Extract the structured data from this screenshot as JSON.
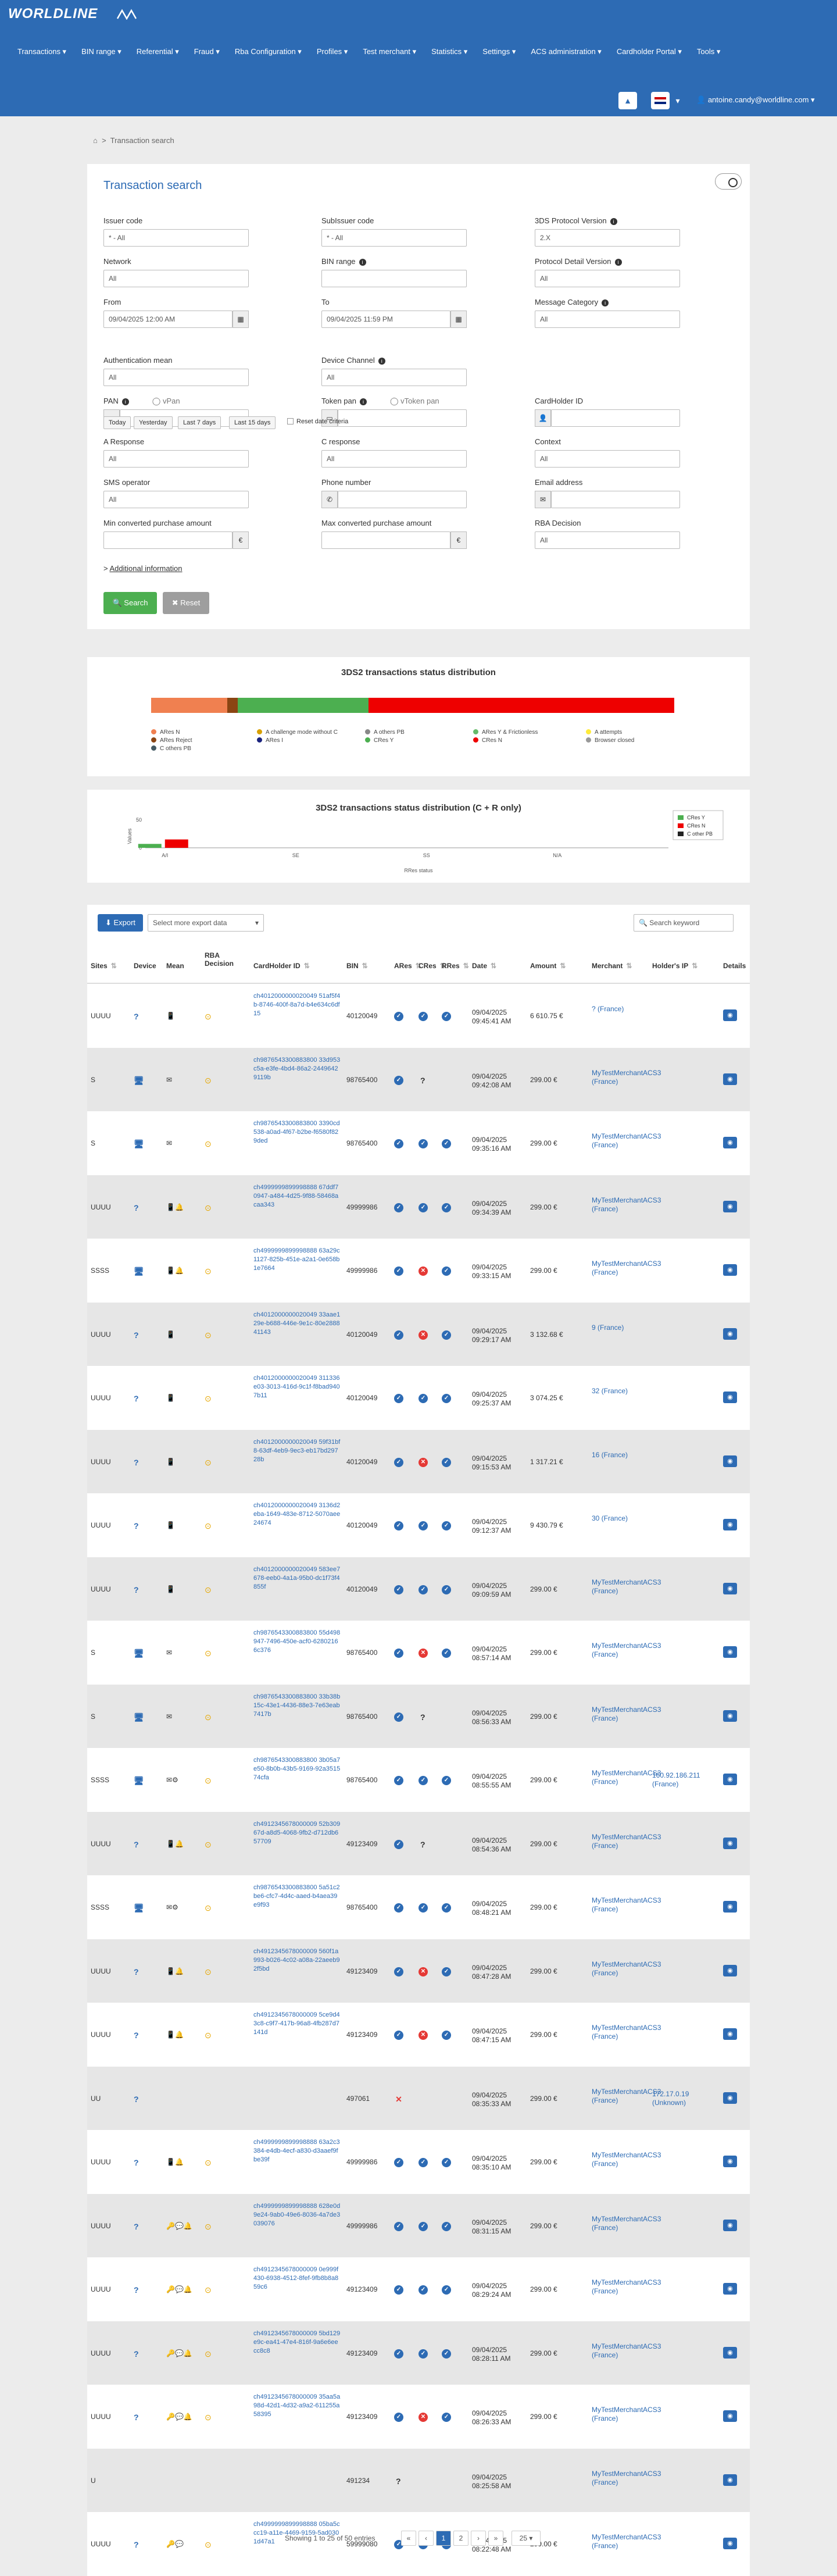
{
  "header": {
    "brand": "WORLDLINE",
    "menu": [
      "Transactions",
      "BIN range",
      "Referential",
      "Fraud",
      "Rba Configuration",
      "Profiles",
      "Test merchant",
      "Statistics",
      "Settings",
      "ACS administration",
      "Cardholder Portal",
      "Tools"
    ],
    "user": "antoine.candy@worldline.com"
  },
  "breadcrumb": {
    "home": "⌂",
    "current": "Transaction search"
  },
  "search": {
    "title": "Transaction search",
    "labels": {
      "issuer_code": "Issuer code",
      "subissuer_code": "SubIssuer code",
      "protocol": "3DS Protocol Version",
      "network": "Network",
      "bin_range": "BIN range",
      "protocol_detail": "Protocol Detail Version",
      "from": "From",
      "to": "To",
      "message_category": "Message Category",
      "auth_mean": "Authentication mean",
      "device_channel": "Device Channel",
      "pan": "PAN",
      "vpan": "vPan",
      "token_pan": "Token pan",
      "vtoken_pan": "vToken pan",
      "cardholder_id": "CardHolder ID",
      "a_response": "A Response",
      "c_response": "C response",
      "context": "Context",
      "sms_operator": "SMS operator",
      "phone_number": "Phone number",
      "email_address": "Email address",
      "min_amount": "Min converted purchase amount",
      "max_amount": "Max converted purchase amount",
      "rba_decision": "RBA Decision"
    },
    "values": {
      "issuer_code": "* - All",
      "subissuer_code": "* - All",
      "protocol": "2.X",
      "network": "All",
      "bin_range": "",
      "protocol_detail": "All",
      "from": "09/04/2025 12:00 AM",
      "to": "09/04/2025 11:59 PM",
      "message_category": "All",
      "auth_mean": "All",
      "device_channel": "All",
      "a_response": "All",
      "c_response": "All",
      "context": "All",
      "sms_operator": "All",
      "rba_decision": "All"
    },
    "quick": [
      "Today",
      "Yesterday",
      "Last 7 days",
      "Last 15 days"
    ],
    "reset_dates": "Reset date criteria",
    "additional": "Additional information",
    "search_btn": "Search",
    "reset_btn": "Reset"
  },
  "dist1": {
    "title": "3DS2 transactions status distribution",
    "legend": [
      "ARes N",
      "ARes Reject",
      "A challenge mode without C",
      "ARes I",
      "A others PB",
      "CRes Y",
      "ARes Y & Frictionless",
      "CRes N",
      "A attempts",
      "Browser closed",
      "C others PB"
    ],
    "colors": {
      "ARes N": "#f08050",
      "ARes Reject": "#8b4513",
      "A challenge mode without C": "#d8a000",
      "ARes I": "#1a237e",
      "A others PB": "#888888",
      "CRes Y": "#4caf50",
      "ARes Y & Frictionless": "#66bb6a",
      "CRes N": "#ee0000",
      "A attempts": "#ffeb3b",
      "Browser closed": "#999999",
      "C others PB": "#455a64"
    },
    "segments": [
      {
        "name": "ARes N",
        "share": 0.145
      },
      {
        "name": "ARes Reject",
        "share": 0.02
      },
      {
        "name": "CRes Y",
        "share": 0.25
      },
      {
        "name": "CRes N",
        "share": 0.585
      }
    ]
  },
  "chart_data": {
    "type": "bar",
    "title": "3DS2 transactions status distribution (C + R only)",
    "xlabel": "RRes status",
    "ylabel": "Values",
    "categories": [
      "A/I",
      "SE",
      "SS",
      "N/A"
    ],
    "series": [
      {
        "name": "CRes Y",
        "values": [
          7,
          0,
          0,
          0
        ]
      },
      {
        "name": "CRes N",
        "values": [
          15,
          0,
          0,
          0
        ]
      },
      {
        "name": "C other PB",
        "values": [
          0,
          0,
          0,
          0
        ]
      }
    ],
    "yticks": [
      0,
      50
    ],
    "ylim": [
      0,
      50
    ],
    "colors": [
      "#4caf50",
      "#ee0000",
      "#222222"
    ],
    "legend": "right"
  },
  "toolbar": {
    "export": "Export",
    "select_export": "Select more export data",
    "search_placeholder": "Search keyword"
  },
  "table": {
    "columns": [
      "Sites",
      "Device",
      "Mean",
      "RBA Decision",
      "CardHolder ID",
      "BIN",
      "ARes",
      "CRes",
      "RRes",
      "Date",
      "Amount",
      "Merchant",
      "Holder's IP",
      "Details"
    ],
    "rows": [
      {
        "sites": "UUUU",
        "device": "?",
        "mean": "📱",
        "rba": "⊙",
        "id": "ch4012000000020049 51af5f4b-8746-400f-8a7d-b4e634c6df15",
        "bin": "40120049",
        "ares": "ok",
        "cres": "ok",
        "rres": "ok",
        "date": "09/04/2025 09:45:41 AM",
        "amount": "6 610.75 €",
        "merchant": "? (France)",
        "ip": ""
      },
      {
        "sites": "S",
        "device": "🖥",
        "mean": "✉",
        "rba": "⊙",
        "id": "ch9876543300883800 33d953c5a-e3fe-4bd4-86a2-24496429119b",
        "bin": "98765400",
        "ares": "ok",
        "cres": "?",
        "rres": "",
        "date": "09/04/2025 09:42:08 AM",
        "amount": "299.00 €",
        "merchant": "MyTestMerchantACS3 (France)",
        "ip": ""
      },
      {
        "sites": "S",
        "device": "🖥",
        "mean": "✉",
        "rba": "⊙",
        "id": "ch9876543300883800 3390cd538-a0ad-4f67-b2be-f6580f829ded",
        "bin": "98765400",
        "ares": "ok",
        "cres": "ok",
        "rres": "ok",
        "date": "09/04/2025 09:35:16 AM",
        "amount": "299.00 €",
        "merchant": "MyTestMerchantACS3 (France)",
        "ip": ""
      },
      {
        "sites": "UUUU",
        "device": "?",
        "mean": "📱🔔",
        "rba": "⊙",
        "id": "ch4999999899998888 67ddf70947-a484-4d25-9f88-58468acaa343",
        "bin": "49999986",
        "ares": "ok",
        "cres": "ok",
        "rres": "ok",
        "date": "09/04/2025 09:34:39 AM",
        "amount": "299.00 €",
        "merchant": "MyTestMerchantACS3 (France)",
        "ip": ""
      },
      {
        "sites": "SSSS",
        "device": "🖥",
        "mean": "📱🔔",
        "rba": "⊙",
        "id": "ch4999999899998888 63a29c1127-825b-451e-a2a1-0e658b1e7664",
        "bin": "49999986",
        "ares": "ok",
        "cres": "no",
        "rres": "ok",
        "date": "09/04/2025 09:33:15 AM",
        "amount": "299.00 €",
        "merchant": "MyTestMerchantACS3 (France)",
        "ip": ""
      },
      {
        "sites": "UUUU",
        "device": "?",
        "mean": "📱",
        "rba": "⊙",
        "id": "ch4012000000020049 33aae129e-b688-446e-9e1c-80e288841143",
        "bin": "40120049",
        "ares": "ok",
        "cres": "no",
        "rres": "ok",
        "date": "09/04/2025 09:29:17 AM",
        "amount": "3 132.68 €",
        "merchant": "9 (France)",
        "ip": ""
      },
      {
        "sites": "UUUU",
        "device": "?",
        "mean": "📱",
        "rba": "⊙",
        "id": "ch4012000000020049 311336e03-3013-416d-9c1f-f8bad9407b11",
        "bin": "40120049",
        "ares": "ok",
        "cres": "ok",
        "rres": "ok",
        "date": "09/04/2025 09:25:37 AM",
        "amount": "3 074.25 €",
        "merchant": "32 (France)",
        "ip": ""
      },
      {
        "sites": "UUUU",
        "device": "?",
        "mean": "📱",
        "rba": "⊙",
        "id": "ch4012000000020049 59f31bf8-63df-4eb9-9ec3-eb17bd29728b",
        "bin": "40120049",
        "ares": "ok",
        "cres": "no",
        "rres": "ok",
        "date": "09/04/2025 09:15:53 AM",
        "amount": "1 317.21 €",
        "merchant": "16 (France)",
        "ip": ""
      },
      {
        "sites": "UUUU",
        "device": "?",
        "mean": "📱",
        "rba": "⊙",
        "id": "ch4012000000020049 3136d2eba-1649-483e-8712-5070aee24674",
        "bin": "40120049",
        "ares": "ok",
        "cres": "ok",
        "rres": "ok",
        "date": "09/04/2025 09:12:37 AM",
        "amount": "9 430.79 €",
        "merchant": "30 (France)",
        "ip": ""
      },
      {
        "sites": "UUUU",
        "device": "?",
        "mean": "📱",
        "rba": "⊙",
        "id": "ch4012000000020049 583ee7678-eeb0-4a1a-95b0-dc1f73f4855f",
        "bin": "40120049",
        "ares": "ok",
        "cres": "ok",
        "rres": "ok",
        "date": "09/04/2025 09:09:59 AM",
        "amount": "299.00 €",
        "merchant": "MyTestMerchantACS3 (France)",
        "ip": ""
      },
      {
        "sites": "S",
        "device": "🖥",
        "mean": "✉",
        "rba": "⊙",
        "id": "ch9876543300883800 55d498947-7496-450e-acf0-62802166c376",
        "bin": "98765400",
        "ares": "ok",
        "cres": "no",
        "rres": "ok",
        "date": "09/04/2025 08:57:14 AM",
        "amount": "299.00 €",
        "merchant": "MyTestMerchantACS3 (France)",
        "ip": ""
      },
      {
        "sites": "S",
        "device": "🖥",
        "mean": "✉",
        "rba": "⊙",
        "id": "ch9876543300883800 33b38b15c-43e1-4436-88e3-7e63eab7417b",
        "bin": "98765400",
        "ares": "ok",
        "cres": "?",
        "rres": "",
        "date": "09/04/2025 08:56:33 AM",
        "amount": "299.00 €",
        "merchant": "MyTestMerchantACS3 (France)",
        "ip": ""
      },
      {
        "sites": "SSSS",
        "device": "🖥",
        "mean": "✉⚙",
        "rba": "⊙",
        "id": "ch9876543300883800 3b05a7e50-8b0b-43b5-9169-92a351574cfa",
        "bin": "98765400",
        "ares": "ok",
        "cres": "ok",
        "rres": "ok",
        "date": "09/04/2025 08:55:55 AM",
        "amount": "299.00 €",
        "merchant": "MyTestMerchantACS3 (France)",
        "ip": "160.92.186.211 (France)"
      },
      {
        "sites": "UUUU",
        "device": "?",
        "mean": "📱🔔",
        "rba": "⊙",
        "id": "ch4912345678000009 52b30967d-a8d5-4068-9fb2-d712db657709",
        "bin": "49123409",
        "ares": "ok",
        "cres": "?",
        "rres": "",
        "date": "09/04/2025 08:54:36 AM",
        "amount": "299.00 €",
        "merchant": "MyTestMerchantACS3 (France)",
        "ip": ""
      },
      {
        "sites": "SSSS",
        "device": "🖥",
        "mean": "✉⚙",
        "rba": "⊙",
        "id": "ch9876543300883800 5a51c2be6-cfc7-4d4c-aaed-b4aea39e9f93",
        "bin": "98765400",
        "ares": "ok",
        "cres": "ok",
        "rres": "ok",
        "date": "09/04/2025 08:48:21 AM",
        "amount": "299.00 €",
        "merchant": "MyTestMerchantACS3 (France)",
        "ip": ""
      },
      {
        "sites": "UUUU",
        "device": "?",
        "mean": "📱🔔",
        "rba": "⊙",
        "id": "ch4912345678000009 560f1a993-b026-4c02-a08a-22aeeb92f5bd",
        "bin": "49123409",
        "ares": "ok",
        "cres": "no",
        "rres": "ok",
        "date": "09/04/2025 08:47:28 AM",
        "amount": "299.00 €",
        "merchant": "MyTestMerchantACS3 (France)",
        "ip": ""
      },
      {
        "sites": "UUUU",
        "device": "?",
        "mean": "📱🔔",
        "rba": "⊙",
        "id": "ch4912345678000009 5ce9d43c8-c9f7-417b-96a8-4fb287d7141d",
        "bin": "49123409",
        "ares": "ok",
        "cres": "no",
        "rres": "ok",
        "date": "09/04/2025 08:47:15 AM",
        "amount": "299.00 €",
        "merchant": "MyTestMerchantACS3 (France)",
        "ip": ""
      },
      {
        "sites": "UU",
        "device": "?",
        "mean": "",
        "rba": "",
        "id": "",
        "bin": "497061",
        "ares": "x",
        "cres": "",
        "rres": "",
        "date": "09/04/2025 08:35:33 AM",
        "amount": "299.00 €",
        "merchant": "MyTestMerchantACS3 (France)",
        "ip": "172.17.0.19 (Unknown)"
      },
      {
        "sites": "UUUU",
        "device": "?",
        "mean": "📱🔔",
        "rba": "⊙",
        "id": "ch4999999899998888 63a2c3384-e4db-4ecf-a830-d3aaef9fbe39f",
        "bin": "49999986",
        "ares": "ok",
        "cres": "ok",
        "rres": "ok",
        "date": "09/04/2025 08:35:10 AM",
        "amount": "299.00 €",
        "merchant": "MyTestMerchantACS3 (France)",
        "ip": ""
      },
      {
        "sites": "UUUU",
        "device": "?",
        "mean": "🔑💬🔔",
        "rba": "⊙",
        "id": "ch4999999899998888 628e0d9e24-9ab0-49e6-8036-4a7de3039076",
        "bin": "49999986",
        "ares": "ok",
        "cres": "ok",
        "rres": "ok",
        "date": "09/04/2025 08:31:15 AM",
        "amount": "299.00 €",
        "merchant": "MyTestMerchantACS3 (France)",
        "ip": ""
      },
      {
        "sites": "UUUU",
        "device": "?",
        "mean": "🔑💬🔔",
        "rba": "⊙",
        "id": "ch4912345678000009 0e999f430-6938-4512-8fef-9fb8b8a859c6",
        "bin": "49123409",
        "ares": "ok",
        "cres": "ok",
        "rres": "ok",
        "date": "09/04/2025 08:29:24 AM",
        "amount": "299.00 €",
        "merchant": "MyTestMerchantACS3 (France)",
        "ip": ""
      },
      {
        "sites": "UUUU",
        "device": "?",
        "mean": "🔑💬🔔",
        "rba": "⊙",
        "id": "ch4912345678000009 5bd129e9c-ea41-47e4-816f-9a6e6eecc8c8",
        "bin": "49123409",
        "ares": "ok",
        "cres": "ok",
        "rres": "ok",
        "date": "09/04/2025 08:28:11 AM",
        "amount": "299.00 €",
        "merchant": "MyTestMerchantACS3 (France)",
        "ip": ""
      },
      {
        "sites": "UUUU",
        "device": "?",
        "mean": "🔑💬🔔",
        "rba": "⊙",
        "id": "ch4912345678000009 35aa5a98d-42d1-4d32-a9a2-611255a58395",
        "bin": "49123409",
        "ares": "ok",
        "cres": "no",
        "rres": "ok",
        "date": "09/04/2025 08:26:33 AM",
        "amount": "299.00 €",
        "merchant": "MyTestMerchantACS3 (France)",
        "ip": ""
      },
      {
        "sites": "U",
        "device": "",
        "mean": "",
        "rba": "",
        "id": "",
        "bin": "491234",
        "ares": "?",
        "cres": "",
        "rres": "",
        "date": "09/04/2025 08:25:58 AM",
        "amount": "",
        "merchant": "MyTestMerchantACS3 (France)",
        "ip": ""
      },
      {
        "sites": "UUUU",
        "device": "?",
        "mean": "🔑💬",
        "rba": "⊙",
        "id": "ch4999999899998888 05ba5ccc19-a11e-4469-9159-5ad0301d47a1",
        "bin": "59999080",
        "ares": "ok",
        "cres": "ok",
        "rres": "ok",
        "date": "09/04/2025 08:22:48 AM",
        "amount": "299.00 €",
        "merchant": "MyTestMerchantACS3 (France)",
        "ip": ""
      }
    ]
  },
  "pagination": {
    "info": "Showing 1 to 25 of 50 entries",
    "first": "«",
    "prev": "‹",
    "pages": [
      "1",
      "2"
    ],
    "next": "›",
    "last": "»",
    "per_page": "25"
  }
}
